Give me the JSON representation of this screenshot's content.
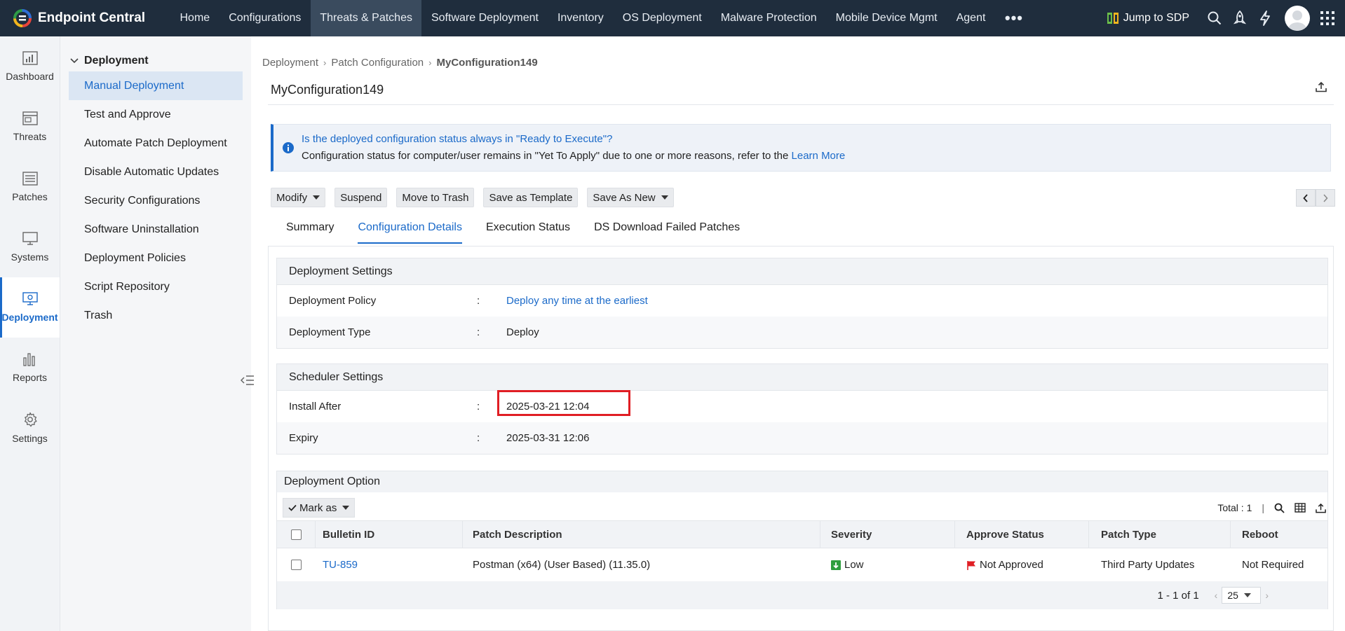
{
  "app": {
    "brand": "Endpoint Central",
    "nav": [
      "Home",
      "Configurations",
      "Threats & Patches",
      "Software Deployment",
      "Inventory",
      "OS Deployment",
      "Malware Protection",
      "Mobile Device Mgmt",
      "Agent"
    ],
    "active_nav": "Threats & Patches",
    "more": "•••",
    "jump_label": "Jump to SDP"
  },
  "rail": {
    "items": [
      "Dashboard",
      "Threats",
      "Patches",
      "Systems",
      "Deployment",
      "Reports",
      "Settings"
    ],
    "active": "Deployment"
  },
  "subnav": {
    "heading": "Deployment",
    "items": [
      "Manual Deployment",
      "Test and Approve",
      "Automate Patch Deployment",
      "Disable Automatic Updates",
      "Security Configurations",
      "Software Uninstallation",
      "Deployment Policies",
      "Script Repository",
      "Trash"
    ],
    "active": "Manual Deployment"
  },
  "breadcrumb": [
    "Deployment",
    "Patch Configuration",
    "MyConfiguration149"
  ],
  "page_title": "MyConfiguration149",
  "info": {
    "question": "Is the deployed configuration status always in \"Ready to Execute\"?",
    "message": "Configuration status for computer/user remains in \"Yet To Apply\" due to one or more reasons, refer to the",
    "link": "Learn More"
  },
  "toolbar": {
    "modify": "Modify",
    "suspend": "Suspend",
    "trash": "Move to Trash",
    "template": "Save as Template",
    "save_new": "Save As New"
  },
  "tabs": [
    "Summary",
    "Configuration Details",
    "Execution Status",
    "DS Download Failed Patches"
  ],
  "active_tab": "Configuration Details",
  "deployment_settings": {
    "heading": "Deployment Settings",
    "policy_label": "Deployment Policy",
    "policy_value": "Deploy any time at the earliest",
    "type_label": "Deployment Type",
    "type_value": "Deploy",
    "colon": ":"
  },
  "scheduler_settings": {
    "heading": "Scheduler Settings",
    "install_label": "Install After",
    "install_value": "2025-03-21 12:04",
    "expiry_label": "Expiry",
    "expiry_value": "2025-03-31 12:06"
  },
  "deployment_option": {
    "heading": "Deployment Option",
    "mark_as": "Mark as",
    "total": "Total : 1",
    "total_sep": "|",
    "columns": [
      "Bulletin ID",
      "Patch Description",
      "Severity",
      "Approve Status",
      "Patch Type",
      "Reboot"
    ],
    "rows": [
      {
        "bulletin": "TU-859",
        "description": "Postman (x64) (User Based) (11.35.0)",
        "severity": "Low",
        "approve": "Not Approved",
        "type": "Third Party Updates",
        "reboot": "Not Required"
      }
    ],
    "range": "1 - 1 of 1",
    "page_size": "25"
  },
  "colors": {
    "topbar": "#1f2d3d",
    "accent": "#1b6ac9",
    "highlight": "#e01e24",
    "severity_low": "#2e9e3e",
    "flag": "#e01e24"
  }
}
